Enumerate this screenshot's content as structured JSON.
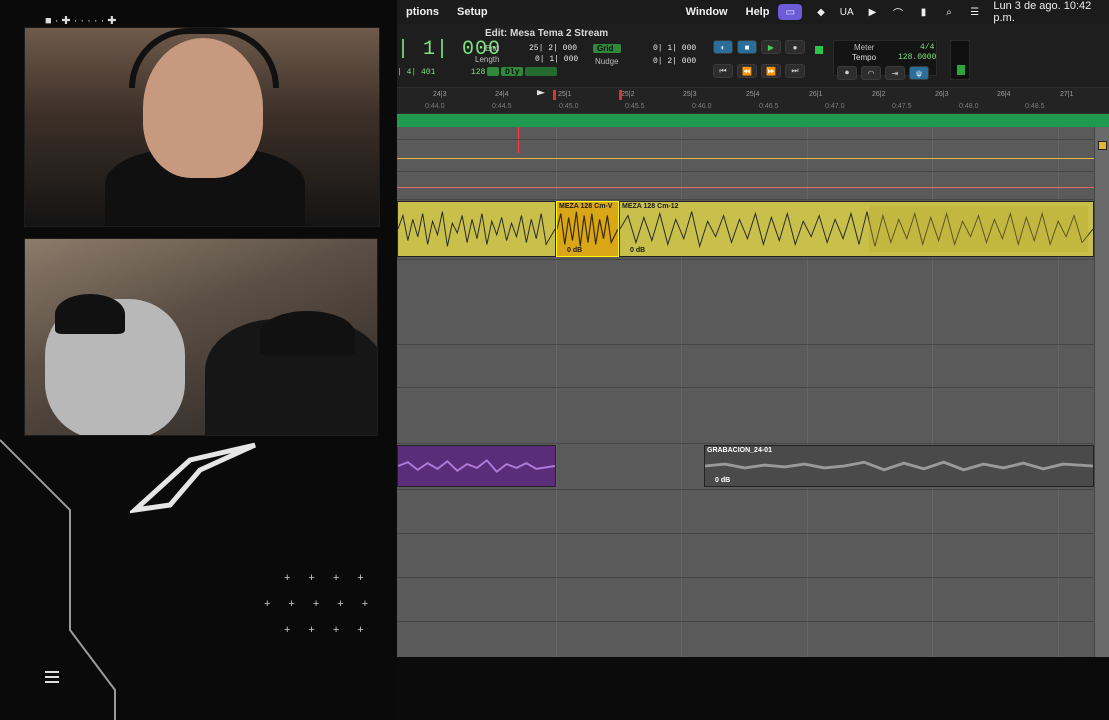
{
  "menubar": {
    "items": [
      "ptions",
      "Setup",
      "Window",
      "Help"
    ],
    "right_label": "UA",
    "clock": "Lun 3 de ago.  10:42 p.m."
  },
  "toolbar": {
    "window_title": "Edit: Mesa Tema 2 Stream",
    "main_counter": "| 1| 000",
    "sub_counter": "| 4| 401",
    "end_label": "End",
    "end_value": "25| 2| 000",
    "length_label": "Length",
    "length_value": "0| 1| 000",
    "grid_label": "Grid",
    "grid_value": "0| 1| 000",
    "nudge_label": "Nudge",
    "nudge_value": "0| 2| 000",
    "small_value": "128",
    "dly_label": "Dly",
    "meter_label": "Meter",
    "tempo_label": "Tempo",
    "time_sig": "4/4",
    "tempo_value": "128.0000"
  },
  "ruler": {
    "bars": [
      "24|3",
      "24|4",
      "25|1",
      "25|2",
      "25|3",
      "25|4",
      "26|1",
      "26|2",
      "26|3",
      "26|4",
      "27|1"
    ],
    "times": [
      "0:44.0",
      "0:44.5",
      "0:45.0",
      "0:45.5",
      "0:46.0",
      "0:46.5",
      "0:47.0",
      "0:47.5",
      "0:48.0",
      "0:48.5"
    ]
  },
  "clips": {
    "clip_a_name": "MEZA 128 Cm-V",
    "clip_a_gain": "0 dB",
    "clip_b_name": "MEZA 128 Cm-12",
    "clip_b_gain": "0 dB",
    "clip_c_name": "GRABACION_24-01",
    "clip_c_gain": "0 dB"
  },
  "colors": {
    "accent_green": "#1f9a4f",
    "clip_yellow": "#c8c04a",
    "clip_purple": "#5b2c7a",
    "menu_active": "#6e5bd8"
  }
}
